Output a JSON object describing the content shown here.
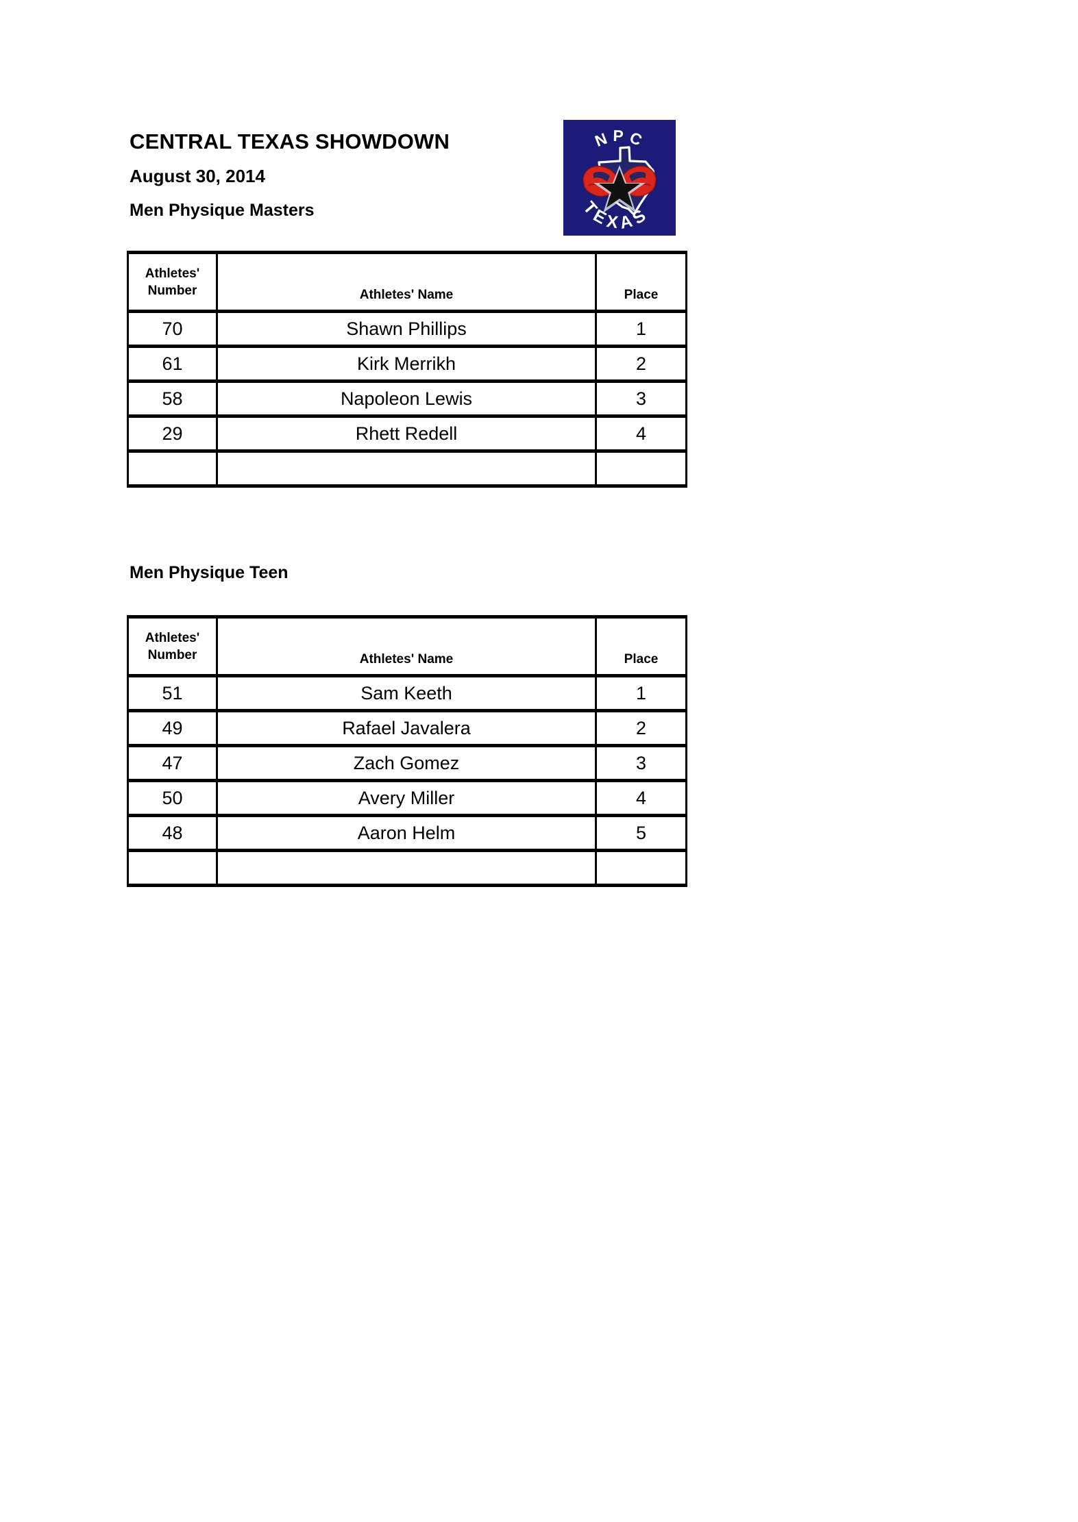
{
  "page": {
    "background": "#ffffff",
    "ink": "#000000"
  },
  "header": {
    "title": "CENTRAL TEXAS SHOWDOWN",
    "date": "August 30, 2014",
    "division": "Men Physique Masters"
  },
  "logo": {
    "name": "npc-texas-logo",
    "top_text": "NPC",
    "bottom_text": "TEXAS",
    "background_color": "#1b1c78",
    "accent_color": "#d9261c",
    "outline_color": "#ffffff",
    "star_color": "#111111"
  },
  "columns": {
    "number_line1": "Athletes'",
    "number_line2": "Number",
    "name": "Athletes' Name",
    "place": "Place"
  },
  "sections": [
    {
      "id": "masters",
      "heading": "Men Physique Masters",
      "rows": [
        {
          "number": "70",
          "name": "Shawn Phillips",
          "place": "1"
        },
        {
          "number": "61",
          "name": "Kirk Merrikh",
          "place": "2"
        },
        {
          "number": "58",
          "name": "Napoleon Lewis",
          "place": "3"
        },
        {
          "number": "29",
          "name": "Rhett Redell",
          "place": "4"
        },
        {
          "number": "",
          "name": "",
          "place": ""
        }
      ]
    },
    {
      "id": "teen",
      "heading": "Men Physique Teen",
      "rows": [
        {
          "number": "51",
          "name": "Sam Keeth",
          "place": "1"
        },
        {
          "number": "49",
          "name": "Rafael Javalera",
          "place": "2"
        },
        {
          "number": "47",
          "name": "Zach Gomez",
          "place": "3"
        },
        {
          "number": "50",
          "name": "Avery Miller",
          "place": "4"
        },
        {
          "number": "48",
          "name": "Aaron Helm",
          "place": "5"
        },
        {
          "number": "",
          "name": "",
          "place": ""
        }
      ]
    }
  ]
}
